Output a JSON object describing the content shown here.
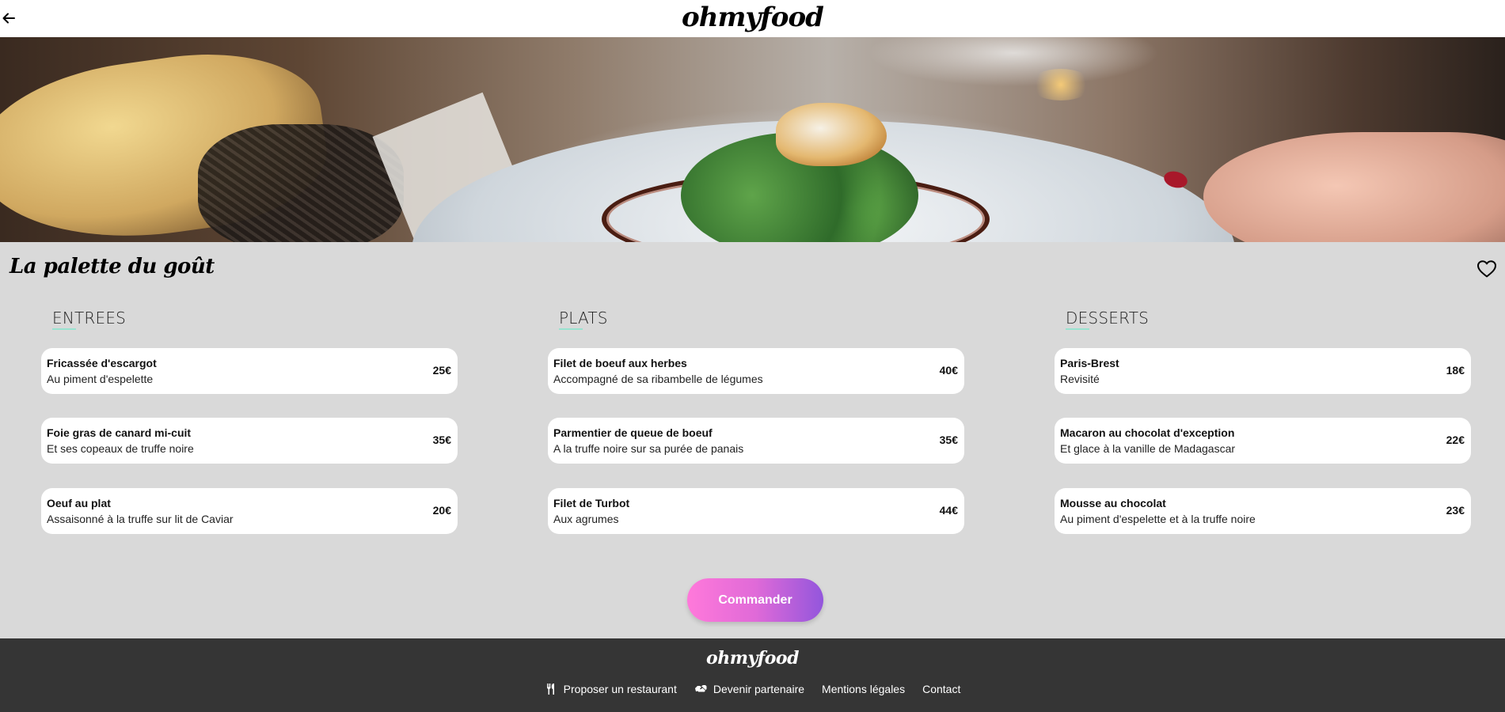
{
  "header": {
    "logo": "ohmyfood",
    "back_icon": "arrow-left-icon"
  },
  "hero": {
    "image_alt": "plated dish with greens and fish"
  },
  "restaurant": {
    "name": "La palette du goût",
    "favorite_icon": "heart-outline-icon"
  },
  "menu": {
    "entrees": {
      "heading": "ENTREES",
      "items": [
        {
          "name": "Fricassée d'escargot",
          "desc": "Au piment d'espelette",
          "price": "25€"
        },
        {
          "name": "Foie gras de canard mi-cuit",
          "desc": "Et ses copeaux de truffe noire",
          "price": "35€"
        },
        {
          "name": "Oeuf au plat",
          "desc": "Assaisonné à la truffe sur lit de Caviar",
          "price": "20€"
        }
      ]
    },
    "plats": {
      "heading": "PLATS",
      "items": [
        {
          "name": "Filet de boeuf aux herbes",
          "desc": "Accompagné de sa ribambelle de légumes",
          "price": "40€"
        },
        {
          "name": "Parmentier de queue de boeuf",
          "desc": "A la truffe noire sur sa purée de panais",
          "price": "35€"
        },
        {
          "name": "Filet de Turbot",
          "desc": "Aux agrumes",
          "price": "44€"
        }
      ]
    },
    "desserts": {
      "heading": "DESSERTS",
      "items": [
        {
          "name": "Paris-Brest",
          "desc": "Revisité",
          "price": "18€"
        },
        {
          "name": "Macaron au chocolat d'exception",
          "desc": "Et glace à la vanille de Madagascar",
          "price": "22€"
        },
        {
          "name": "Mousse au chocolat",
          "desc": "Au piment d'espelette et à la truffe noire",
          "price": "23€"
        }
      ]
    }
  },
  "order_button": "Commander",
  "footer": {
    "logo": "ohmyfood",
    "links": [
      {
        "label": "Proposer un restaurant",
        "icon": "utensils-icon"
      },
      {
        "label": "Devenir partenaire",
        "icon": "handshake-icon"
      },
      {
        "label": "Mentions légales"
      },
      {
        "label": "Contact"
      }
    ]
  },
  "colors": {
    "background": "#d9d9d9",
    "footer": "#353535",
    "accent_underline": "#99e2d0",
    "button_gradient_start": "#ff79da",
    "button_gradient_end": "#9356dc"
  }
}
